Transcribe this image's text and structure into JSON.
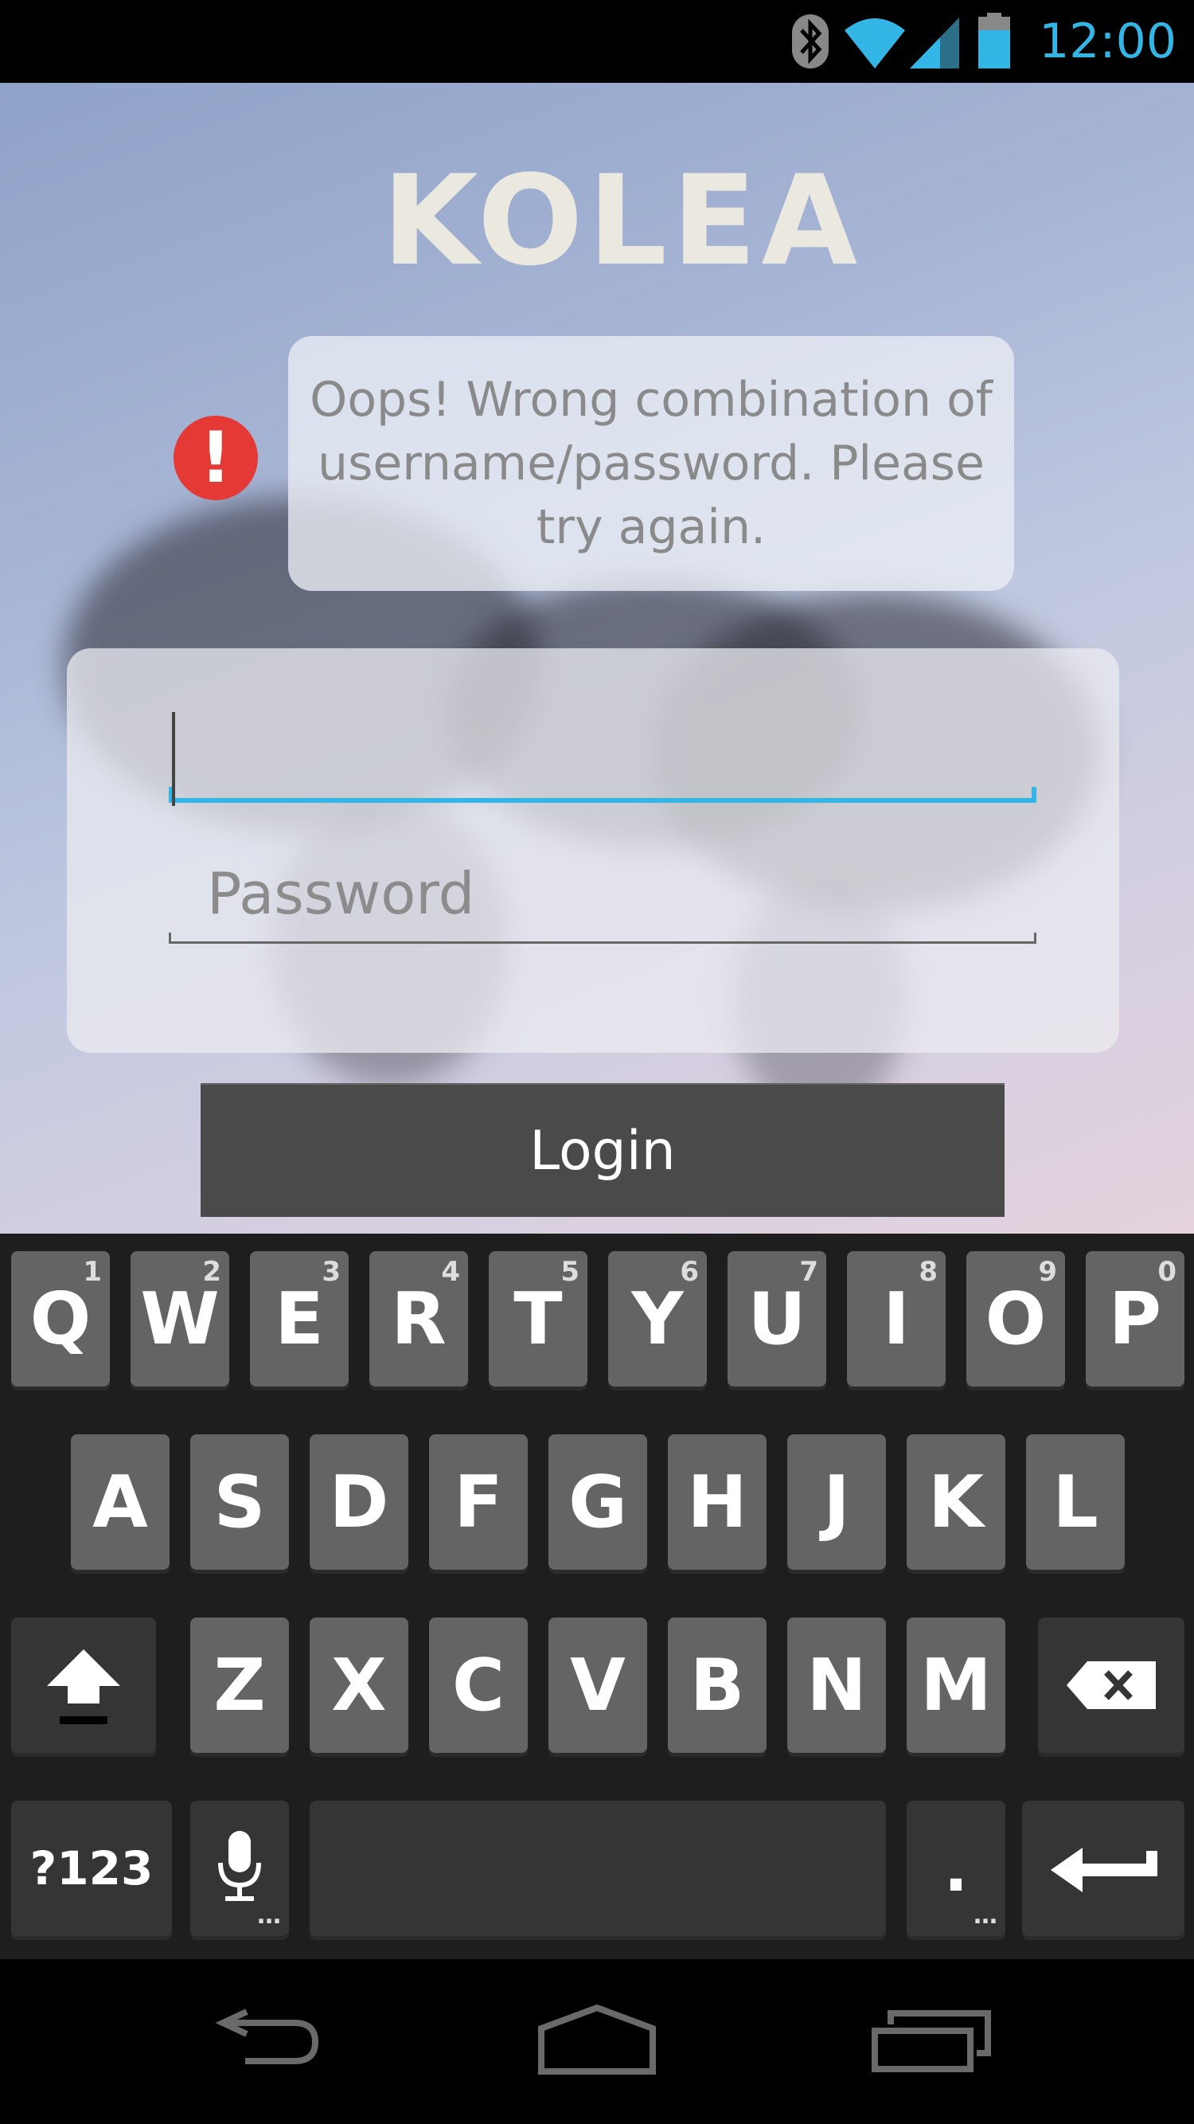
{
  "status_bar": {
    "time": "12:00",
    "icons": [
      "bluetooth-icon",
      "wifi-icon",
      "cell-signal-icon",
      "battery-icon"
    ],
    "accent_color": "#33b5e5"
  },
  "app": {
    "logo_text": "KOLEA",
    "error": {
      "icon": "alert-icon",
      "icon_glyph": "!",
      "message": "Oops! Wrong combination of username/password. Please try again."
    },
    "form": {
      "username_value": "",
      "password_placeholder": "Password"
    },
    "login_label": "Login"
  },
  "keyboard": {
    "row1": [
      {
        "label": "Q",
        "hint": "1"
      },
      {
        "label": "W",
        "hint": "2"
      },
      {
        "label": "E",
        "hint": "3"
      },
      {
        "label": "R",
        "hint": "4"
      },
      {
        "label": "T",
        "hint": "5"
      },
      {
        "label": "Y",
        "hint": "6"
      },
      {
        "label": "U",
        "hint": "7"
      },
      {
        "label": "I",
        "hint": "8"
      },
      {
        "label": "O",
        "hint": "9"
      },
      {
        "label": "P",
        "hint": "0"
      }
    ],
    "row2": [
      "A",
      "S",
      "D",
      "F",
      "G",
      "H",
      "J",
      "K",
      "L"
    ],
    "row3": [
      "Z",
      "X",
      "C",
      "V",
      "B",
      "N",
      "M"
    ],
    "symbols_label": "?123",
    "period_label": ".",
    "more_glyph": "…",
    "special_icons": [
      "shift-icon",
      "backspace-icon",
      "microphone-icon",
      "enter-icon"
    ]
  },
  "nav_bar": {
    "icons": [
      "back-icon",
      "home-icon",
      "recent-apps-icon"
    ]
  }
}
